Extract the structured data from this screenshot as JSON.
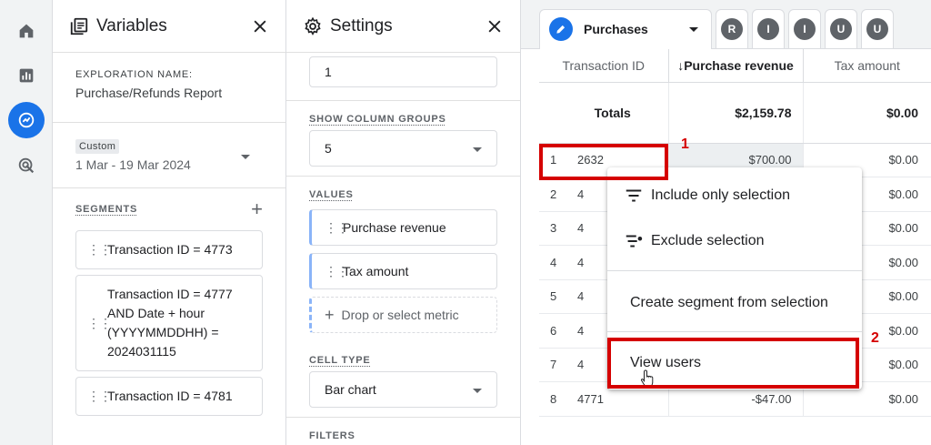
{
  "variables": {
    "title": "Variables",
    "exploration_label": "EXPLORATION NAME:",
    "exploration_value": "Purchase/Refunds Report",
    "date_chip": "Custom",
    "date_range": "1 Mar - 19 Mar 2024",
    "segments_label": "SEGMENTS",
    "segments": [
      "Transaction ID = 4773",
      "Transaction ID = 4777 AND Date + hour (YYYYMMDDHH) = 2024031115",
      "Transaction ID = 4781"
    ]
  },
  "settings": {
    "title": "Settings",
    "rows_value": "1",
    "column_groups_label": "SHOW COLUMN GROUPS",
    "column_groups_value": "5",
    "values_label": "VALUES",
    "values": [
      "Purchase revenue",
      "Tax amount"
    ],
    "drop_metric": "Drop or select metric",
    "cell_type_label": "CELL TYPE",
    "cell_type_value": "Bar chart",
    "filters_label": "FILTERS"
  },
  "report": {
    "tab_name": "Purchases",
    "tab_letters": [
      "R",
      "I",
      "I",
      "U",
      "U"
    ],
    "columns": [
      "Transaction ID",
      "Purchase revenue",
      "Tax amount"
    ],
    "sort_arrow": "↓",
    "totals_label": "Totals",
    "totals_revenue": "$2,159.78",
    "totals_tax": "$0.00",
    "rows": [
      {
        "n": "1",
        "id": "2632",
        "rev": "$700.00",
        "tax": "$0.00"
      },
      {
        "n": "2",
        "id": "4",
        "rev": "",
        "tax": "$0.00"
      },
      {
        "n": "3",
        "id": "4",
        "rev": "",
        "tax": "$0.00"
      },
      {
        "n": "4",
        "id": "4",
        "rev": "",
        "tax": "$0.00"
      },
      {
        "n": "5",
        "id": "4",
        "rev": "",
        "tax": "$0.00"
      },
      {
        "n": "6",
        "id": "4",
        "rev": "",
        "tax": "$0.00"
      },
      {
        "n": "7",
        "id": "4",
        "rev": "",
        "tax": "$0.00"
      },
      {
        "n": "8",
        "id": "4771",
        "rev": "-$47.00",
        "tax": "$0.00"
      }
    ]
  },
  "context_menu": {
    "include": "Include only selection",
    "exclude": "Exclude selection",
    "create_segment": "Create segment from selection",
    "view_users": "View users"
  },
  "annotations": {
    "badge_1": "1",
    "badge_2": "2"
  },
  "colors": {
    "accent": "#1a73e8",
    "highlight": "#d50000"
  },
  "icons": [
    "home-icon",
    "reports-icon",
    "explore-icon",
    "advertising-icon",
    "variables-icon",
    "settings-gear-icon",
    "close-icon",
    "pencil-icon",
    "filter-icon",
    "filter-remove-icon",
    "hand-cursor-icon"
  ]
}
